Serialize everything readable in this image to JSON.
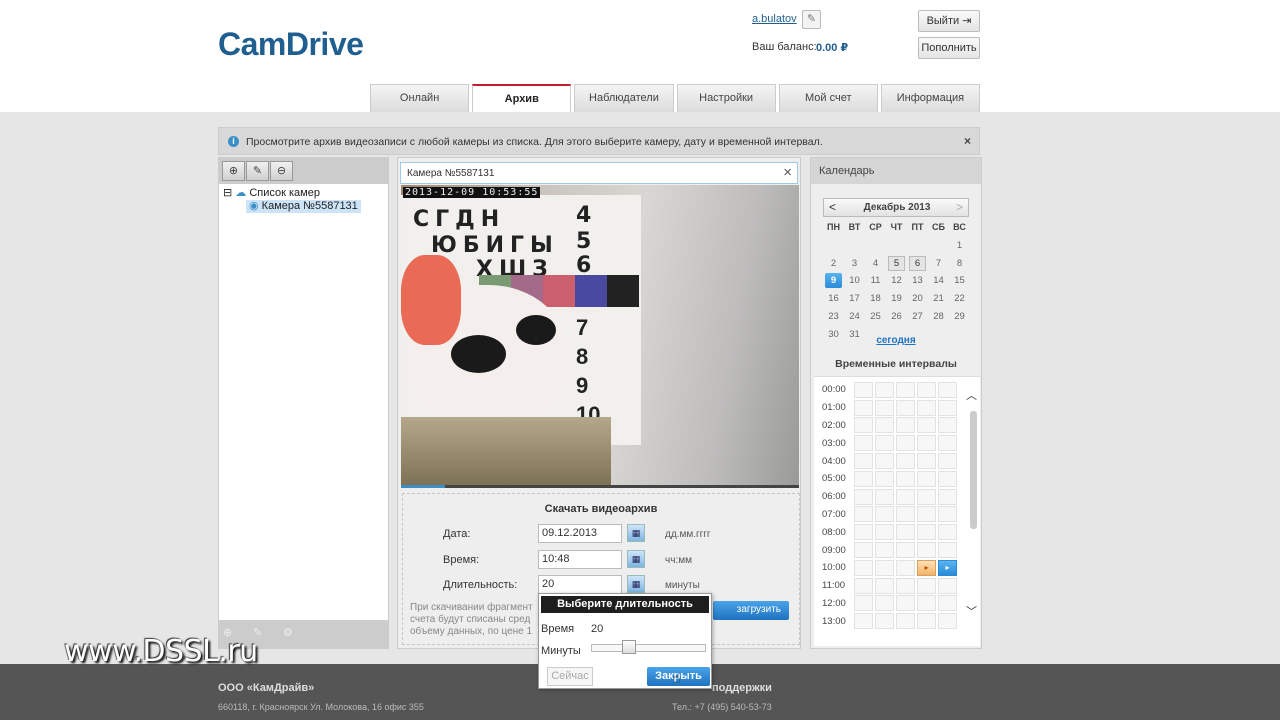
{
  "header": {
    "logo": "CamDrive",
    "user": "a.bulatov",
    "balance_label": "Ваш баланс:",
    "balance_value": "0.00 ₽",
    "logout_label": "Выйти",
    "topup_label": "Пополнить"
  },
  "nav": {
    "tabs": [
      {
        "label": "Онлайн"
      },
      {
        "label": "Архив"
      },
      {
        "label": "Наблюдатели"
      },
      {
        "label": "Настройки"
      },
      {
        "label": "Мой счет"
      },
      {
        "label": "Информация"
      }
    ],
    "active": 1
  },
  "info": {
    "text": "Просмотрите архив видеозаписи с любой камеры из списка. Для этого выберите камеру, дату и временной интервал.",
    "close": "×"
  },
  "tree": {
    "root": "Список камер",
    "item": "Камера №5587131"
  },
  "video": {
    "title": "Камера №5587131",
    "timestamp": "2013-12-09 10:53:55",
    "progress": 0.11
  },
  "download": {
    "title": "Скачать видеоархив",
    "date_label": "Дата:",
    "date_value": "09.12.2013",
    "date_hint": "дд.мм.гггг",
    "time_label": "Время:",
    "time_value": "10:48",
    "time_hint": "чч:мм",
    "duration_label": "Длительность:",
    "duration_value": "20",
    "duration_hint": "минуты",
    "note": "При скачивании фрагмент счета будут списаны сред объему данных, по цене 1",
    "load_button": "загрузить"
  },
  "popup": {
    "title": "Выберите длительность",
    "time_label": "Время",
    "time_value": "20",
    "minutes_label": "Минуты",
    "slider_value": 0.33,
    "now_button": "Сейчас",
    "close_button": "Закрыть"
  },
  "calendar": {
    "header": "Календарь",
    "prev": "<",
    "next": ">",
    "month": "Декабрь 2013",
    "weekdays": [
      "ПН",
      "ВТ",
      "СР",
      "ЧТ",
      "ПТ",
      "СБ",
      "ВС"
    ],
    "weeks": [
      [
        "",
        "",
        "",
        "",
        "",
        "",
        "1"
      ],
      [
        "2",
        "3",
        "4",
        "5",
        "6",
        "7",
        "8"
      ],
      [
        "9",
        "10",
        "11",
        "12",
        "13",
        "14",
        "15"
      ],
      [
        "16",
        "17",
        "18",
        "19",
        "20",
        "21",
        "22"
      ],
      [
        "23",
        "24",
        "25",
        "26",
        "27",
        "28",
        "29"
      ],
      [
        "30",
        "31",
        "",
        "",
        "",
        "",
        ""
      ]
    ],
    "boxed_days": [
      "5",
      "6"
    ],
    "selected_day": "9",
    "today_link": "сегодня"
  },
  "intervals": {
    "title": "Временные интервалы",
    "times": [
      "00:00",
      "01:00",
      "02:00",
      "03:00",
      "04:00",
      "05:00",
      "06:00",
      "07:00",
      "08:00",
      "09:00",
      "10:00",
      "11:00",
      "12:00",
      "13:00"
    ]
  },
  "footer": {
    "company": "ООО «КамДрайв»",
    "address": "660118, г. Красноярск Ул. Молокова, 16 офис 355",
    "support": "поддержки",
    "phone": "Тел.: +7 (495) 540-53-73"
  },
  "watermark": "www.DSSL.ru",
  "colors": {
    "brand": "#1f5f8f",
    "accent": "#2a8ad8",
    "active_tab": "#c0202a"
  }
}
